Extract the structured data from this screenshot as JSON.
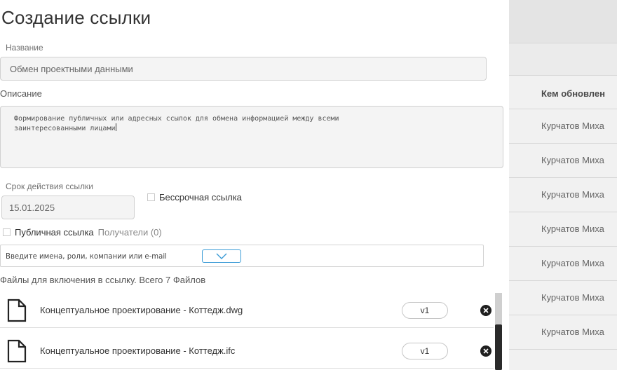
{
  "modal": {
    "title": "Создание ссылки",
    "name_label": "Название",
    "name_value": "Обмен проектными данными",
    "description_label": "Описание",
    "description_value": "Формирование публичных или адресных ссылок для обмена информацией между всеми\nзаинтересованными лицами",
    "expiry_label": "Срок действия ссылки",
    "expiry_value": "15.01.2025",
    "unlimited_label": "Бессрочная ссылка",
    "public_label": "Публичная ссылка",
    "recipients_label": "Получатели (0)",
    "recipients_placeholder": "Введите имена, роли, компании или e-mail",
    "files_title": "Файлы для включения в ссылку. Всего 7 Файлов",
    "files": [
      {
        "name": "Концептуальное проектирование - Коттедж.dwg",
        "version": "v1"
      },
      {
        "name": "Концептуальное проектирование - Коттедж.ifc",
        "version": "v1"
      }
    ]
  },
  "background_table": {
    "column_header": "Кем обновлен",
    "rows": [
      "Курчатов Миха",
      "Курчатов Миха",
      "Курчатов Миха",
      "Курчатов Миха",
      "Курчатов Миха",
      "Курчатов Миха",
      "Курчатов Миха"
    ]
  },
  "colors": {
    "accent": "#3a9bd6",
    "field_bg": "#f4f4f4",
    "border": "#d0d0d0"
  },
  "icons": [
    "file-icon",
    "chevron-down-icon",
    "remove-icon",
    "checkbox-icon"
  ]
}
